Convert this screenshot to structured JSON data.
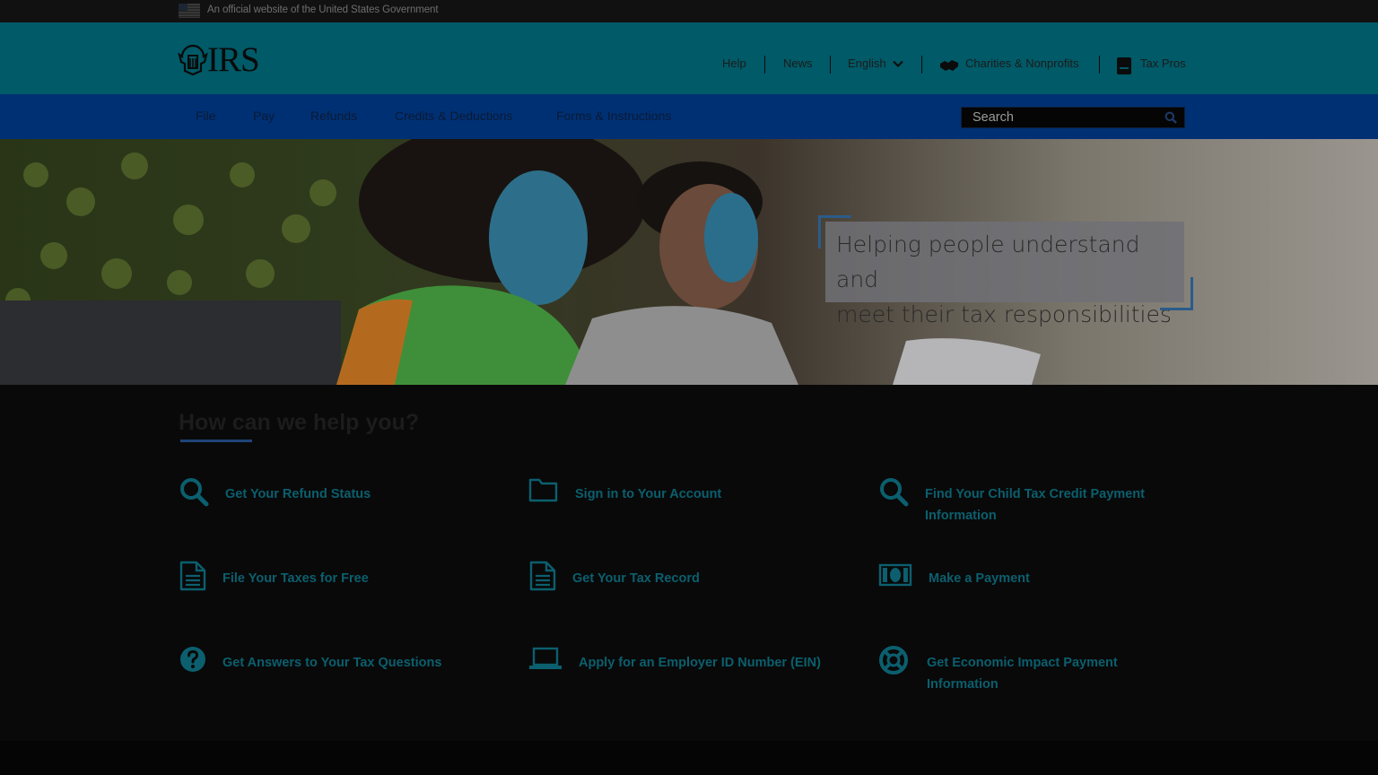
{
  "banner": {
    "text": "An official website of the United States Government"
  },
  "header": {
    "logo_text": "IRS",
    "utility": [
      {
        "label": "Help"
      },
      {
        "label": "News"
      },
      {
        "label": "English"
      },
      {
        "label": "Charities & Nonprofits",
        "icon": "handshake-icon"
      },
      {
        "label": "Tax Pros",
        "icon": "book-icon"
      }
    ]
  },
  "nav": {
    "items": [
      {
        "label": "File"
      },
      {
        "label": "Pay"
      },
      {
        "label": "Refunds"
      },
      {
        "label": "Credits & Deductions"
      },
      {
        "label": "Forms & Instructions"
      }
    ],
    "search_placeholder": "Search"
  },
  "hero": {
    "line1": "Helping people understand and",
    "line2": "meet their tax responsibilities"
  },
  "help": {
    "title": "How can we help you?",
    "tiles": [
      {
        "label_1": "Get Your Refund Status",
        "label_2": "",
        "icon": "search-icon"
      },
      {
        "label_1": "Sign in to Your Account",
        "label_2": "",
        "icon": "folder-icon"
      },
      {
        "label_1": "Find Your Child Tax Credit Payment",
        "label_2": "Information",
        "icon": "search-icon"
      },
      {
        "label_1": "File Your Taxes for Free",
        "label_2": "",
        "icon": "document-icon"
      },
      {
        "label_1": "Get Your Tax Record",
        "label_2": "",
        "icon": "document-icon"
      },
      {
        "label_1": "Make a Payment",
        "label_2": "",
        "icon": "money-icon"
      },
      {
        "label_1": "Get Answers to Your Tax Questions",
        "label_2": "",
        "icon": "question-icon"
      },
      {
        "label_1": "Apply for an Employer ID Number (EIN)",
        "label_2": "",
        "icon": "laptop-icon"
      },
      {
        "label_1": "Get Economic Impact Payment",
        "label_2": "Information",
        "icon": "lifebuoy-icon"
      }
    ]
  },
  "colors": {
    "header": "#005a67",
    "nav": "#003074",
    "link": "#0b5f6e",
    "background": "#090909"
  }
}
